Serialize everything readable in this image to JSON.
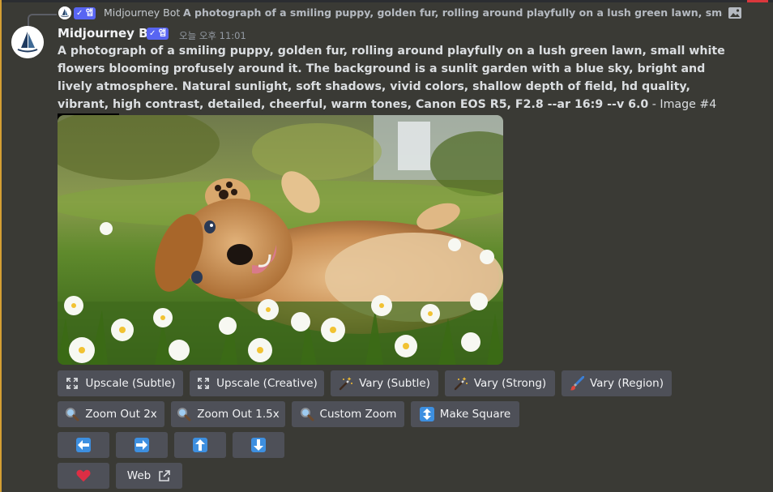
{
  "reply": {
    "author": "Midjourney Bot",
    "badge": "✓ 앱",
    "text": "A photograph of a smiling puppy, golden fur, rolling around playfully on a lush green lawn, small white flow..."
  },
  "message": {
    "author": "Midjourney Bot",
    "badge": "✓ 앱",
    "timestamp": "오늘 오후 11:01",
    "prompt": "A photograph of a smiling puppy, golden fur, rolling around playfully on a lush green lawn, small white flowers blooming profusely around it. The background is a sunlit garden with a blue sky, bright and lively atmosphere. Natural sunlight, soft shadows, vivid colors, shallow depth of field, hd quality, vibrant, high contrast, detailed, cheerful, warm tones, Canon EOS R5, F2.8 --ar 16:9 --v 6.0",
    "suffix": " - Image #4"
  },
  "buttons": {
    "upscale_subtle": "Upscale (Subtle)",
    "upscale_creative": "Upscale (Creative)",
    "vary_subtle": "Vary (Subtle)",
    "vary_strong": "Vary (Strong)",
    "vary_region": "Vary (Region)",
    "zoom_out_2x": "Zoom Out 2x",
    "zoom_out_1_5x": "Zoom Out 1.5x",
    "custom_zoom": "Custom Zoom",
    "make_square": "Make Square",
    "web": "Web"
  },
  "icons": [
    "expand-icon",
    "sparkle-wand-icon",
    "paintbrush-icon",
    "magnifier-icon",
    "vertical-arrows-icon",
    "arrow-left-icon",
    "arrow-right-icon",
    "arrow-up-icon",
    "arrow-down-icon",
    "heart-icon",
    "external-link-icon",
    "image-icon"
  ],
  "colors": {
    "badge": "#5865f2",
    "button": "#4e5058",
    "arrow_blue": "#3d8fe0",
    "heart": "#dd2e44",
    "background": "#3a3a35"
  }
}
